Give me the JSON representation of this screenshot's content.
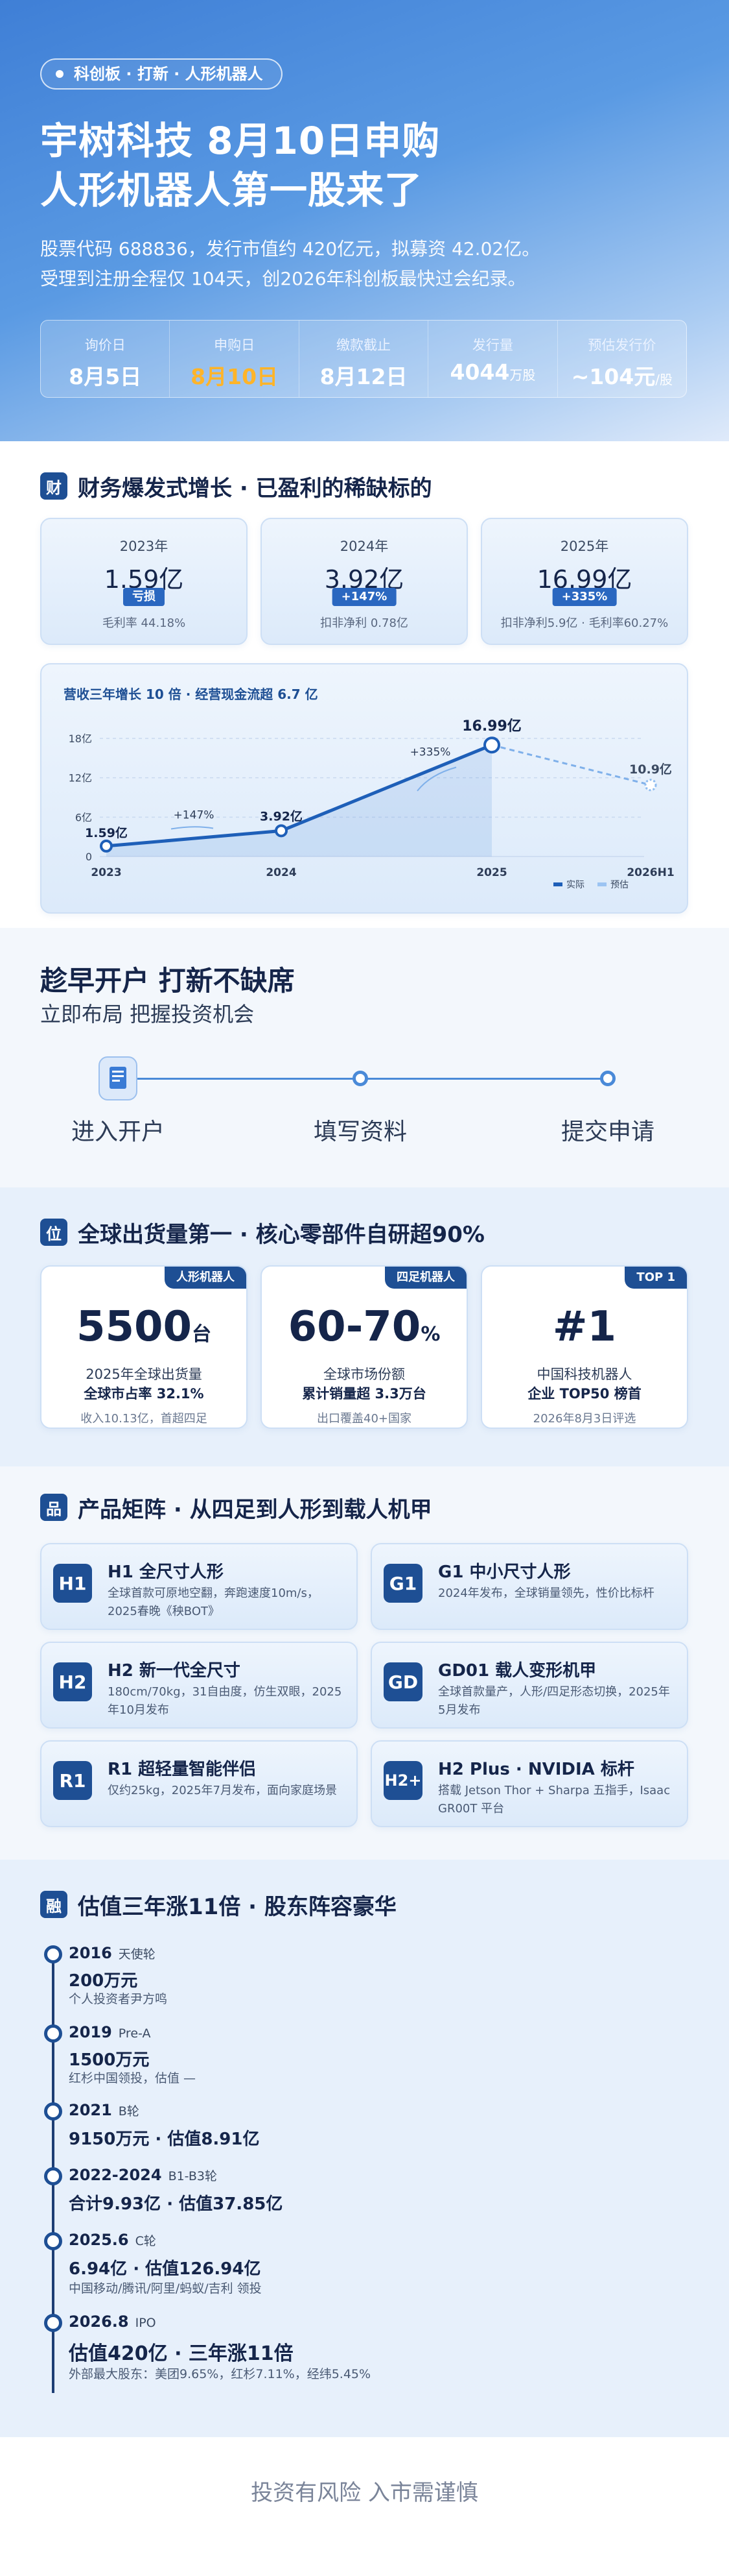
{
  "hero": {
    "tag": "科创板 · 打新 · 人形机器人",
    "title1": "宇树科技  8月10日申购",
    "title2": "人形机器人第一股来了",
    "line1": "股票代码 688836，发行市值约 420亿元，拟募资 42.02亿。",
    "line2": "受理到注册全程仅 104天，创2026年科创板最快过会纪录。",
    "stats": [
      {
        "label": "询价日",
        "value": "8月5日",
        "unit": ""
      },
      {
        "label": "申购日",
        "value": "8月10日",
        "unit": ""
      },
      {
        "label": "缴款截止",
        "value": "8月12日",
        "unit": ""
      },
      {
        "label": "发行量",
        "value": "4044",
        "unit": "万股"
      },
      {
        "label": "预估发行价",
        "value": "~104元",
        "unit": "/股"
      }
    ]
  },
  "finance": {
    "icon": "财",
    "title": "财务爆发式增长 · 已盈利的稀缺标的",
    "cards": [
      {
        "year": "2023年",
        "value": "1.59亿",
        "badge": "亏损",
        "note": "毛利率 44.18%"
      },
      {
        "year": "2024年",
        "value": "3.92亿",
        "badge": "+147%",
        "note": "扣非净利 0.78亿"
      },
      {
        "year": "2025年",
        "value": "16.99亿",
        "badge": "+335%",
        "note": "扣非净利5.9亿 · 毛利率60.27%"
      }
    ]
  },
  "chart_data": {
    "type": "line",
    "title": "营收三年增长 10 倍 · 经营现金流超 6.7 亿",
    "categories": [
      "2023",
      "2024",
      "2025",
      "2026H1"
    ],
    "yticks": [
      "18亿",
      "12亿",
      "6亿",
      "0"
    ],
    "ylim": [
      0,
      18
    ],
    "series": [
      {
        "name": "实际",
        "values": [
          1.59,
          3.92,
          16.99,
          null
        ]
      },
      {
        "name": "预估",
        "values": [
          null,
          null,
          16.99,
          10.9
        ]
      }
    ],
    "data_labels": [
      "1.59亿",
      "3.92亿",
      "16.99亿",
      "10.9亿"
    ],
    "annotations": [
      "+147%",
      "+335%"
    ],
    "legend": [
      "实际",
      "预估"
    ]
  },
  "open": {
    "title": "趁早开户 打新不缺席",
    "subtitle": "立即布局 把握投资机会",
    "steps": [
      "进入开户",
      "填写资料",
      "提交申请"
    ]
  },
  "ship": {
    "icon": "位",
    "title": "全球出货量第一 · 核心零部件自研超90%",
    "cards": [
      {
        "tag": "人形机器人",
        "big": "5500",
        "unit": "台",
        "t1": "2025年全球出货量",
        "t2": "全球市占率 32.1%",
        "t3": "收入10.13亿，首超四足"
      },
      {
        "tag": "四足机器人",
        "big": "60-70",
        "unit": "%",
        "t1": "全球市场份额",
        "t2": "累计销量超 3.3万台",
        "t3": "出口覆盖40+国家"
      },
      {
        "tag": "TOP 1",
        "big": "#1",
        "unit": "",
        "t1": "中国科技机器人",
        "t2": "企业 TOP50 榜首",
        "t3": "2026年8月3日评选"
      }
    ]
  },
  "products": {
    "icon": "品",
    "title": "产品矩阵 · 从四足到人形到载人机甲",
    "items": [
      {
        "code": "H1",
        "name": "H1 全尺寸人形",
        "desc": "全球首款可原地空翻，奔跑速度10m/s，2025春晚《秧BOT》"
      },
      {
        "code": "G1",
        "name": "G1 中小尺寸人形",
        "desc": "2024年发布，全球销量领先，性价比标杆"
      },
      {
        "code": "H2",
        "name": "H2 新一代全尺寸",
        "desc": "180cm/70kg，31自由度，仿生双眼，2025年10月发布"
      },
      {
        "code": "GD",
        "name": "GD01 载人变形机甲",
        "desc": "全球首款量产，人形/四足形态切换，2025年5月发布"
      },
      {
        "code": "R1",
        "name": "R1 超轻量智能伴侣",
        "desc": "仅约25kg，2025年7月发布，面向家庭场景"
      },
      {
        "code": "H2+",
        "name": "H2 Plus · NVIDIA 标杆",
        "desc": "搭载 Jetson Thor + Sharpa 五指手，Isaac GR00T 平台"
      }
    ]
  },
  "valuation": {
    "icon": "融",
    "title": "估值三年涨11倍 · 股东阵容豪华",
    "events": [
      {
        "year": "2016",
        "round": "天使轮",
        "value": "200万元",
        "note": "个人投资者尹方鸣"
      },
      {
        "year": "2019",
        "round": "Pre-A",
        "value": "1500万元",
        "note": "红杉中国领投，估值 —"
      },
      {
        "year": "2021",
        "round": "B轮",
        "value": "9150万元 · 估值8.91亿",
        "note": ""
      },
      {
        "year": "2022-2024",
        "round": "B1-B3轮",
        "value": "合计9.93亿 · 估值37.85亿",
        "note": ""
      },
      {
        "year": "2025.6",
        "round": "C轮",
        "value": "6.94亿 · 估值126.94亿",
        "note": "中国移动/腾讯/阿里/蚂蚁/吉利 领投"
      },
      {
        "year": "2026.8",
        "round": "IPO",
        "value": "估值420亿 · 三年涨11倍",
        "note": "外部最大股东：美团9.65%，红杉7.11%，经纬5.45%"
      }
    ]
  },
  "footer": "投资有风险 入市需谨慎"
}
